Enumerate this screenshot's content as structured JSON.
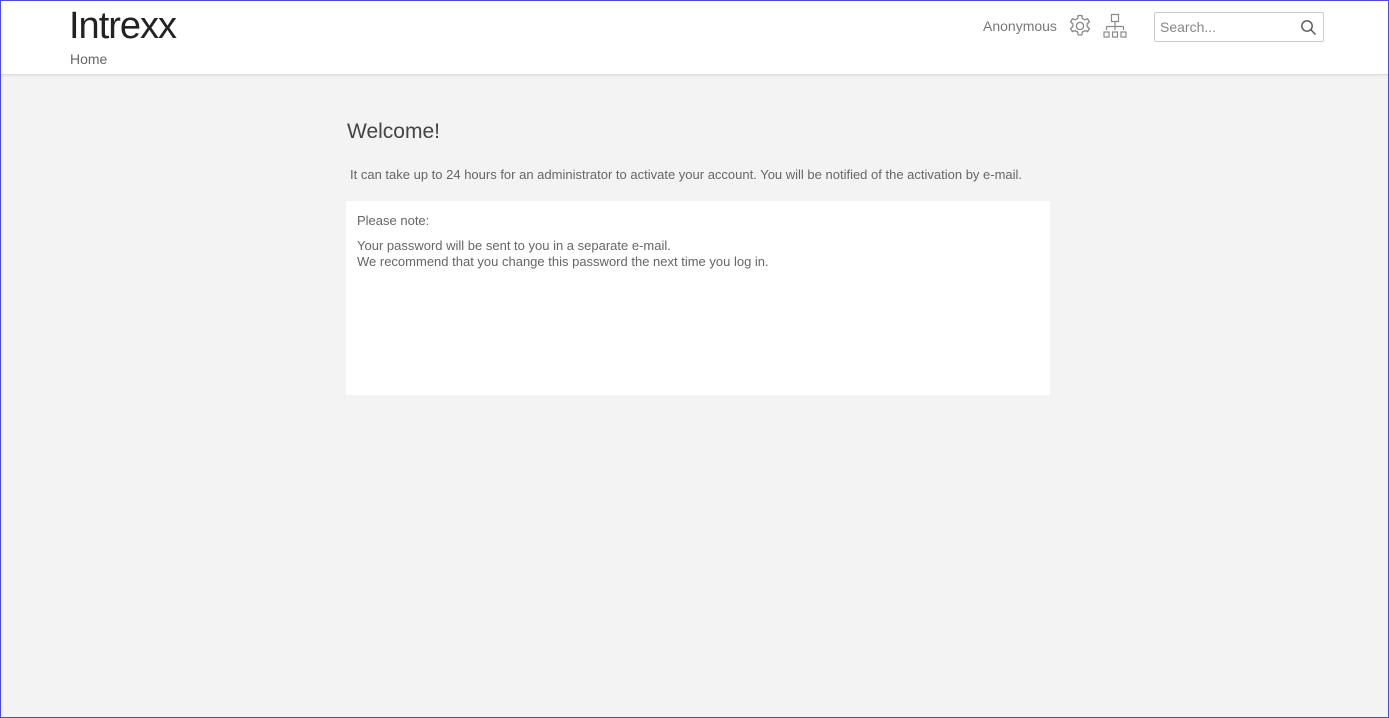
{
  "header": {
    "logo_text": "Intrexx",
    "breadcrumb": "Home",
    "user_name": "Anonymous",
    "settings_icon": "gear-icon",
    "sitemap_icon": "sitemap-icon",
    "search": {
      "placeholder": "Search...",
      "value": "",
      "icon": "search-icon"
    }
  },
  "main": {
    "title": "Welcome!",
    "intro": "It can take up to 24 hours for an administrator to activate your account. You will be notified of the activation by e-mail.",
    "note": {
      "heading": "Please note:",
      "lines": [
        "Your password will be sent to you in a separate e-mail.",
        "We recommend that you change this password the next time you log in."
      ]
    }
  },
  "colors": {
    "background": "#f3f3f3",
    "header_bg": "#ffffff",
    "panel_bg": "#ffffff",
    "text": "#666666",
    "frame_border": "#4a4adf"
  }
}
